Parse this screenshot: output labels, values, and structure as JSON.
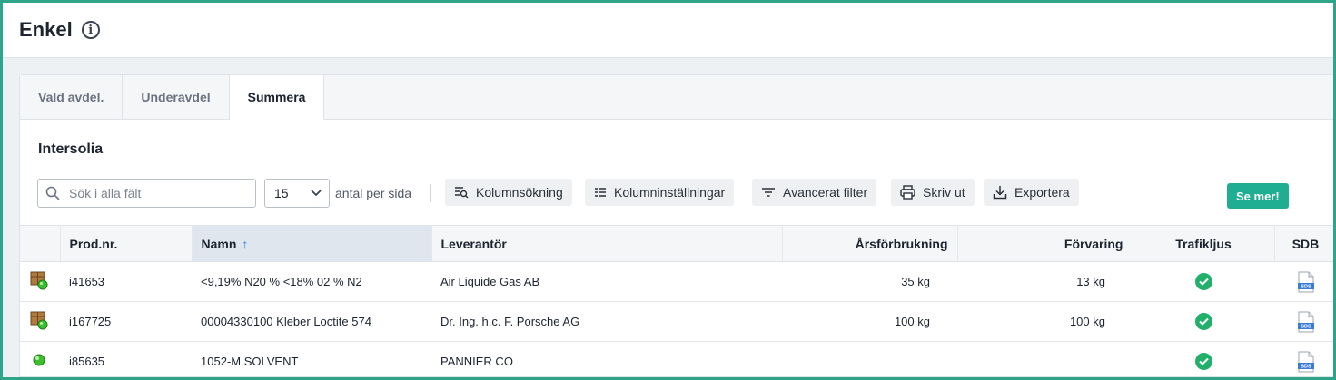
{
  "header": {
    "title": "Enkel",
    "info_icon": "info-icon"
  },
  "tabs": [
    {
      "label": "Vald avdel.",
      "active": false
    },
    {
      "label": "Underavdel",
      "active": false
    },
    {
      "label": "Summera",
      "active": true
    }
  ],
  "section": {
    "title": "Intersolia"
  },
  "toolbar": {
    "search_placeholder": "Sök i alla fält",
    "page_size": "15",
    "per_page_label": "antal per sida",
    "column_search": "Kolumnsökning",
    "column_settings": "Kolumninställningar",
    "advanced_filter": "Avancerat filter",
    "print": "Skriv ut",
    "export": "Exportera",
    "see_more": "Se mer!"
  },
  "colors": {
    "accent": "#1fae91",
    "ok_green": "#20b06a",
    "sort_blue": "#2e7bd6"
  },
  "table": {
    "columns": {
      "prod_nr": "Prod.nr.",
      "namn": "Namn",
      "leverantor": "Leverantör",
      "arsforbrukning": "Årsförbrukning",
      "forvaring": "Förvaring",
      "trafikljus": "Trafikljus",
      "sdb": "SDB"
    },
    "sort": {
      "column": "Namn",
      "direction": "ascending"
    },
    "rows": [
      {
        "icon": "package-green-dot-icon",
        "prod_nr": "i41653",
        "namn": "<9,19% N20 % <18% 02 % N2",
        "leverantor": "Air Liquide Gas AB",
        "arsforbrukning": "35 kg",
        "forvaring": "13 kg",
        "trafikljus": "green-check-icon",
        "sdb": "sds-document-icon"
      },
      {
        "icon": "package-green-dot-icon",
        "prod_nr": "i167725",
        "namn": "00004330100 Kleber Loctite 574",
        "leverantor": "Dr. Ing. h.c. F. Porsche AG",
        "arsforbrukning": "100 kg",
        "forvaring": "100 kg",
        "trafikljus": "green-check-icon",
        "sdb": "sds-document-icon"
      },
      {
        "icon": "green-dot-icon",
        "prod_nr": "i85635",
        "namn": "1052-M SOLVENT",
        "leverantor": "PANNIER CO",
        "arsforbrukning": "",
        "forvaring": "",
        "trafikljus": "green-check-icon",
        "sdb": "sds-document-icon"
      }
    ]
  }
}
